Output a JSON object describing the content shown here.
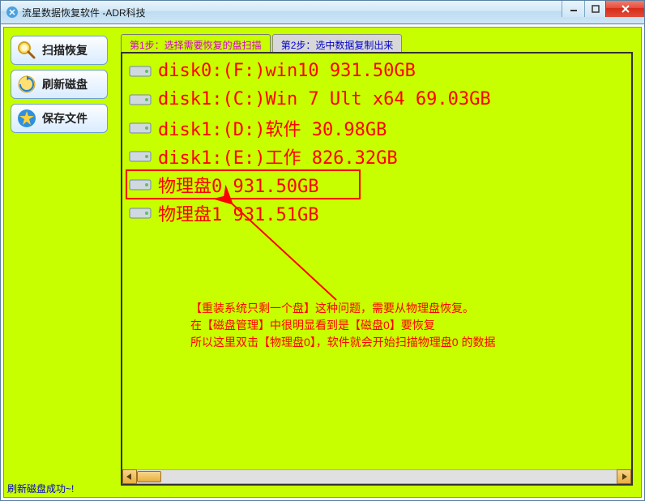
{
  "window": {
    "title": "流星数据恢复软件  -ADR科技"
  },
  "sidebar": {
    "scan_recover": "扫描恢复",
    "refresh_disk": "刷新磁盘",
    "save_files": "保存文件"
  },
  "tabs": {
    "step1": "第1步：选择需要恢复的盘扫描",
    "step2": "第2步：选中数据复制出来"
  },
  "disks": [
    {
      "label": "disk0:(F:)win10 931.50GB"
    },
    {
      "label": "disk1:(C:)Win 7 Ult x64 69.03GB"
    },
    {
      "label": "disk1:(D:)软件 30.98GB"
    },
    {
      "label": "disk1:(E:)工作 826.32GB"
    },
    {
      "label": "物理盘0 931.50GB"
    },
    {
      "label": "物理盘1 931.51GB"
    }
  ],
  "annotation": {
    "line1": "【重装系统只剩一个盘】这种问题，需要从物理盘恢复。",
    "line2": "在【磁盘管理】中很明显看到是【磁盘0】要恢复",
    "line3": "所以这里双击【物理盘0】，软件就会开始扫描物理盘0 的数据"
  },
  "status": "刷新磁盘成功~!",
  "colors": {
    "bg": "#C8FF00",
    "red": "#ff0000"
  }
}
